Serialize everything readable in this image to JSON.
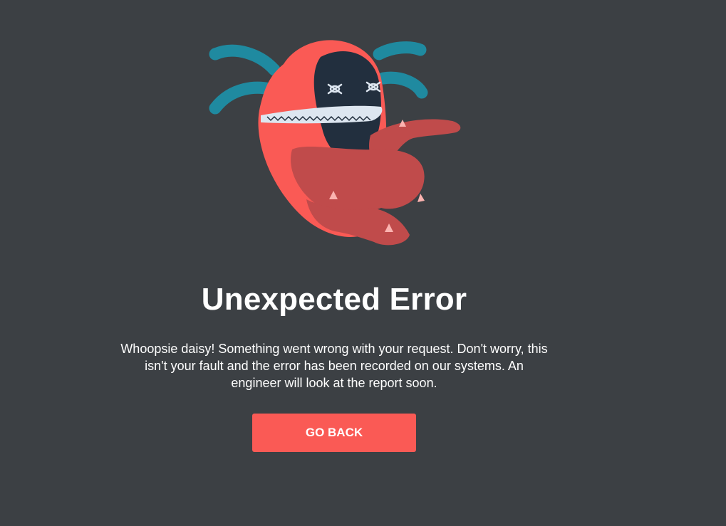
{
  "illustration": {
    "icon": "error-monster-illustration",
    "colors": {
      "body": "#fa5a55",
      "arms": "#c04b4b",
      "face": "#222f3e",
      "antennae": "#1f8aa0",
      "teeth": "#dde6f0"
    }
  },
  "error": {
    "title": "Unexpected Error",
    "message": "Whoopsie daisy! Something went wrong with your request. Don't worry, this isn't your fault and the error has been recorded on our systems. An engineer will look at the report soon."
  },
  "actions": {
    "go_back_label": "GO BACK"
  },
  "theme": {
    "background": "#3c4044",
    "accent": "#fa5a55",
    "text": "#ffffff"
  }
}
